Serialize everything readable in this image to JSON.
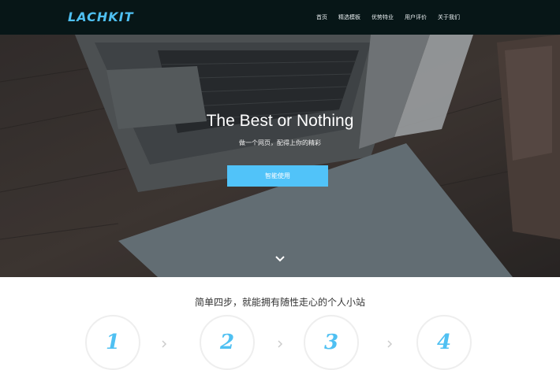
{
  "brand": {
    "logo": "LACHKIT",
    "accent": "#4fc0f2"
  },
  "nav": {
    "items": [
      {
        "label": "首页"
      },
      {
        "label": "精选模板"
      },
      {
        "label": "优势特业"
      },
      {
        "label": "用户评价"
      },
      {
        "label": "关于我们"
      }
    ]
  },
  "hero": {
    "title": "The Best or Nothing",
    "subtitle": "做一个网页，配得上你的精彩",
    "cta_label": "智能使用",
    "scroll_icon": "chevron-down-icon"
  },
  "steps": {
    "title": "简单四步，就能拥有随性走心的个人小站",
    "items": [
      {
        "number": "1"
      },
      {
        "number": "2"
      },
      {
        "number": "3"
      },
      {
        "number": "4"
      }
    ],
    "arrow_icon": "chevron-right-icon"
  }
}
